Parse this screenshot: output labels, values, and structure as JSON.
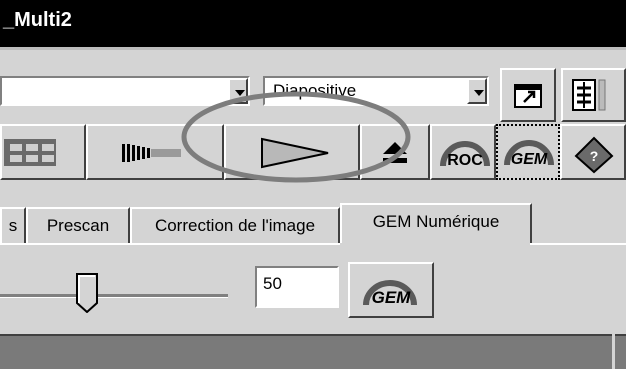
{
  "window": {
    "title": "_Multi2"
  },
  "toolbar_top": {
    "combo_left_value": "",
    "combo_film_value": "Diapositive"
  },
  "tabs": [
    {
      "label": "s",
      "active": false
    },
    {
      "label": "Prescan",
      "active": false
    },
    {
      "label": "Correction de l'image",
      "active": false
    },
    {
      "label": "GEM Numérique",
      "active": true
    }
  ],
  "gem": {
    "slider_value": 50,
    "value_text": "50",
    "slider_fraction": 0.38
  },
  "icons": {
    "roc_text": "ROC",
    "gem_text": "GEM",
    "gem_apply_text": "GEM"
  },
  "colors": {
    "title_bg": "#000000",
    "face": "#d4d4d4",
    "highlight_ellipse": "#7d7d7d"
  }
}
